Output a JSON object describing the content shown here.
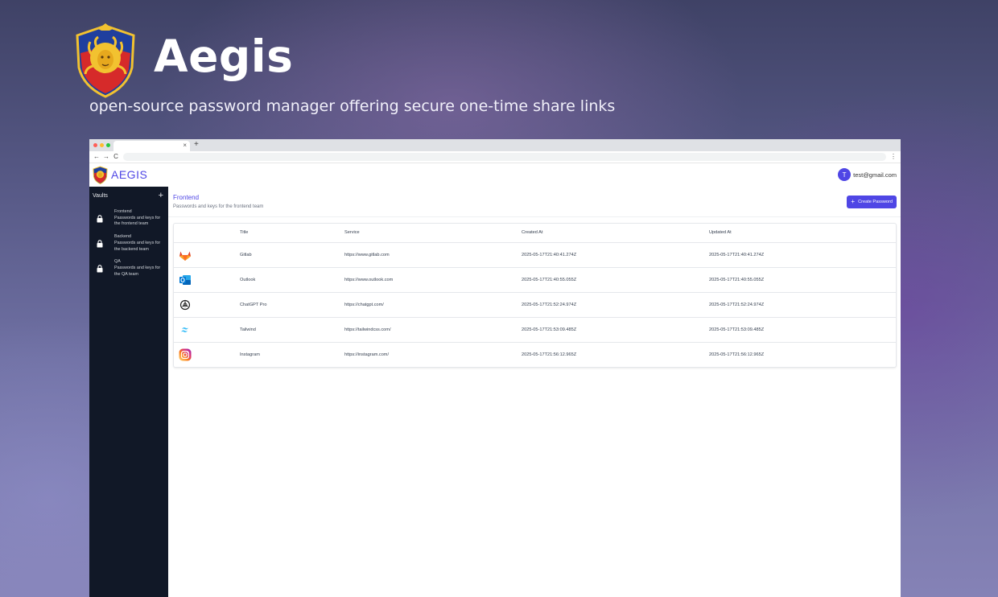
{
  "hero": {
    "title": "Aegis",
    "subtitle": "open-source password manager offering secure one-time share links"
  },
  "browser": {
    "traffic_colors": [
      "#ff5f57",
      "#febc2e",
      "#28c840"
    ],
    "tab_close": "×",
    "new_tab": "+",
    "nav": {
      "back": "←",
      "forward": "→",
      "reload": "C"
    },
    "menu": "⋮"
  },
  "app": {
    "name": "AEGIS",
    "accent": "#4f46e5",
    "sidebar_bg": "#111827",
    "user": {
      "initial": "T",
      "email": "test@gmail.com"
    }
  },
  "sidebar": {
    "title": "Vaults",
    "add_label": "+",
    "vaults": [
      {
        "name": "Frontend",
        "desc": "Passwords and keys for the frontend team"
      },
      {
        "name": "Backend",
        "desc": "Passwords and keys for the backend team"
      },
      {
        "name": "QA",
        "desc": "Passwords and keys for the QA team"
      }
    ]
  },
  "vault": {
    "title": "Frontend",
    "description": "Passwords and keys for the frontend team",
    "create_label": "Create Password",
    "create_icon": "+"
  },
  "table": {
    "headers": [
      "Title",
      "Service",
      "Created At",
      "Updated At"
    ],
    "rows": [
      {
        "icon": "gitlab-icon",
        "title": "Gitlab",
        "service": "https://www.gitlab.com",
        "created": "2025-05-17T21:40:41.274Z",
        "updated": "2025-05-17T21:40:41.274Z"
      },
      {
        "icon": "outlook-icon",
        "title": "Outlook",
        "service": "https://www.outlook.com",
        "created": "2025-05-17T21:40:55.055Z",
        "updated": "2025-05-17T21:40:55.055Z"
      },
      {
        "icon": "chatgpt-icon",
        "title": "ChatGPT Pro",
        "service": "https://chatgpt.com/",
        "created": "2025-05-17T21:52:24.974Z",
        "updated": "2025-05-17T21:52:24.974Z"
      },
      {
        "icon": "tailwind-icon",
        "title": "Tailwind",
        "service": "https://tailwindcss.com/",
        "created": "2025-05-17T21:53:09.485Z",
        "updated": "2025-05-17T21:53:09.485Z"
      },
      {
        "icon": "instagram-icon",
        "title": "Instagram",
        "service": "https://instagram.com/",
        "created": "2025-05-17T21:56:12.965Z",
        "updated": "2025-05-17T21:56:12.965Z"
      }
    ]
  }
}
